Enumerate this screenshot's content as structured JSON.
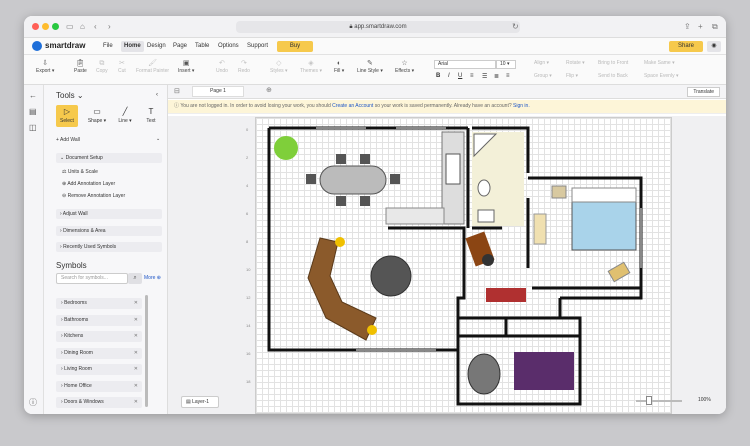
{
  "browser": {
    "url": "app.smartdraw.com"
  },
  "app": {
    "name": "smartdraw"
  },
  "menu": {
    "items": [
      "File",
      "Home",
      "Design",
      "Page",
      "Table",
      "Options",
      "Support"
    ],
    "active": "Home",
    "buy": "Buy",
    "share": "Share"
  },
  "toolbar": {
    "export": "Export",
    "paste": "Paste",
    "copy": "Copy",
    "cut": "Cut",
    "format_painter": "Format Painter",
    "insert": "Insert",
    "undo": "Undo",
    "redo": "Redo",
    "styles": "Styles",
    "themes": "Themes",
    "fill": "Fill",
    "line_style": "Line Style",
    "effects": "Effects",
    "font": "Arial",
    "font_size": "10",
    "align": "Align",
    "group": "Group",
    "rotate": "Rotate",
    "flip": "Flip",
    "spacing": "Spacing",
    "space": "Space",
    "bring_front": "Bring to Front",
    "send_back": "Send to Back",
    "make_same": "Make Same",
    "space_evenly": "Space Evenly",
    "translate": "Translate"
  },
  "tools": {
    "title": "Tools",
    "items": [
      "Select",
      "Shape",
      "Line",
      "Text"
    ],
    "add_wall": "Add Wall",
    "document_setup": "Document Setup",
    "setup_items": [
      "Units & Scale",
      "Add Annotation Layer",
      "Remove Annotation Layer"
    ],
    "sections": [
      "Adjust Wall",
      "Dimensions & Area",
      "Recently Used Symbols"
    ]
  },
  "symbols": {
    "title": "Symbols",
    "search_placeholder": "Search for symbols...",
    "more": "More",
    "libraries": [
      "Bedrooms",
      "Bathrooms",
      "Kitchens",
      "Dining Room",
      "Living Room",
      "Home Office",
      "Doors & Windows"
    ]
  },
  "notice": {
    "pre": "You are not logged in. In order to avoid losing your work, you should",
    "link1": "Create an Account",
    "mid": "so your work is saved permanently. Already have an account?",
    "link2": "Sign in."
  },
  "page": {
    "tab": "Page 1",
    "layer": "Layer-1",
    "zoom": "100%"
  },
  "ruler": {
    "ticks": [
      "0",
      "2",
      "4",
      "6",
      "8",
      "10",
      "12",
      "14",
      "16",
      "18"
    ]
  },
  "colors": {
    "accent": "#f6c94c",
    "link": "#1e56c7",
    "wall": "#111111",
    "bed": "#a9d3ea",
    "sofa": "#8b5a2b"
  }
}
